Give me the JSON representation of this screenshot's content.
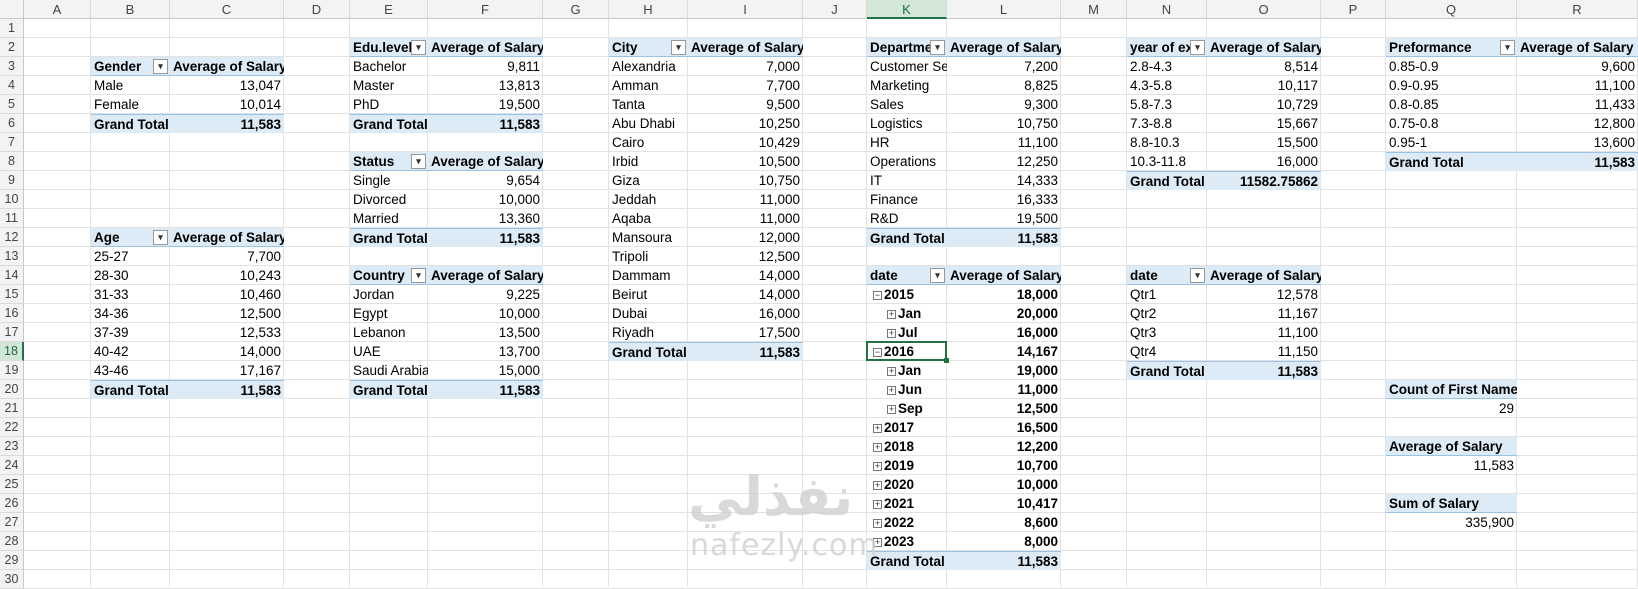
{
  "columns": [
    "A",
    "B",
    "C",
    "D",
    "E",
    "F",
    "G",
    "H",
    "I",
    "J",
    "K",
    "L",
    "M",
    "N",
    "O",
    "P",
    "Q",
    "R"
  ],
  "rows": [
    "1",
    "2",
    "3",
    "4",
    "5",
    "6",
    "7",
    "8",
    "9",
    "10",
    "11",
    "12",
    "13",
    "14",
    "15",
    "16",
    "17",
    "18",
    "19",
    "20",
    "21",
    "22",
    "23",
    "24",
    "25",
    "26",
    "27",
    "28",
    "29",
    "30"
  ],
  "selected": {
    "column": "K",
    "row": "18"
  },
  "gender": {
    "header": [
      "Gender",
      "Average of Salary"
    ],
    "rows": [
      [
        "Male",
        "13,047"
      ],
      [
        "Female",
        "10,014"
      ]
    ],
    "total": [
      "Grand Total",
      "11,583"
    ]
  },
  "age": {
    "header": [
      "Age",
      "Average of Salary"
    ],
    "rows": [
      [
        "25-27",
        "7,700"
      ],
      [
        "28-30",
        "10,243"
      ],
      [
        "31-33",
        "10,460"
      ],
      [
        "34-36",
        "12,500"
      ],
      [
        "37-39",
        "12,533"
      ],
      [
        "40-42",
        "14,000"
      ],
      [
        "43-46",
        "17,167"
      ]
    ],
    "total": [
      "Grand Total",
      "11,583"
    ]
  },
  "edu": {
    "header": [
      "Edu.level",
      "Average of Salary"
    ],
    "rows": [
      [
        "Bachelor",
        "9,811"
      ],
      [
        "Master",
        "13,813"
      ],
      [
        "PhD",
        "19,500"
      ]
    ],
    "total": [
      "Grand Total",
      "11,583"
    ]
  },
  "status": {
    "header": [
      "Status",
      "Average of Salary"
    ],
    "rows": [
      [
        "Single",
        "9,654"
      ],
      [
        "Divorced",
        "10,000"
      ],
      [
        "Married",
        "13,360"
      ]
    ],
    "total": [
      "Grand Total",
      "11,583"
    ]
  },
  "country": {
    "header": [
      "Country",
      "Average of Salary"
    ],
    "rows": [
      [
        "Jordan",
        "9,225"
      ],
      [
        "Egypt",
        "10,000"
      ],
      [
        "Lebanon",
        "13,500"
      ],
      [
        "UAE",
        "13,700"
      ],
      [
        "Saudi Arabia",
        "15,000"
      ]
    ],
    "total": [
      "Grand Total",
      "11,583"
    ]
  },
  "city": {
    "header": [
      "City",
      "Average of Salary"
    ],
    "rows": [
      [
        "Alexandria",
        "7,000"
      ],
      [
        "Amman",
        "7,700"
      ],
      [
        "Tanta",
        "9,500"
      ],
      [
        "Abu Dhabi",
        "10,250"
      ],
      [
        "Cairo",
        "10,429"
      ],
      [
        "Irbid",
        "10,500"
      ],
      [
        "Giza",
        "10,750"
      ],
      [
        "Jeddah",
        "11,000"
      ],
      [
        "Aqaba",
        "11,000"
      ],
      [
        "Mansoura",
        "12,000"
      ],
      [
        "Tripoli",
        "12,500"
      ],
      [
        "Dammam",
        "14,000"
      ],
      [
        "Beirut",
        "14,000"
      ],
      [
        "Dubai",
        "16,000"
      ],
      [
        "Riyadh",
        "17,500"
      ]
    ],
    "total": [
      "Grand Total",
      "11,583"
    ]
  },
  "department": {
    "header": [
      "Departme",
      "Average of Salary"
    ],
    "rows": [
      [
        "Customer Se",
        "7,200"
      ],
      [
        "Marketing",
        "8,825"
      ],
      [
        "Sales",
        "9,300"
      ],
      [
        "Logistics",
        "10,750"
      ],
      [
        "HR",
        "11,100"
      ],
      [
        "Operations",
        "12,250"
      ],
      [
        "IT",
        "14,333"
      ],
      [
        "Finance",
        "16,333"
      ],
      [
        "R&D",
        "19,500"
      ]
    ],
    "total": [
      "Grand Total",
      "11,583"
    ]
  },
  "date_year": {
    "header": [
      "date",
      "Average of Salary"
    ],
    "rows": [
      {
        "label": "2015",
        "value": "18,000",
        "level": 0,
        "sign": "−"
      },
      {
        "label": "Jan",
        "value": "20,000",
        "level": 1,
        "sign": "+"
      },
      {
        "label": "Jul",
        "value": "16,000",
        "level": 1,
        "sign": "+"
      },
      {
        "label": "2016",
        "value": "14,167",
        "level": 0,
        "sign": "−"
      },
      {
        "label": "Jan",
        "value": "19,000",
        "level": 1,
        "sign": "+"
      },
      {
        "label": "Jun",
        "value": "11,000",
        "level": 1,
        "sign": "+"
      },
      {
        "label": "Sep",
        "value": "12,500",
        "level": 1,
        "sign": "+"
      },
      {
        "label": "2017",
        "value": "16,500",
        "level": 0,
        "sign": "+"
      },
      {
        "label": "2018",
        "value": "12,200",
        "level": 0,
        "sign": "+"
      },
      {
        "label": "2019",
        "value": "10,700",
        "level": 0,
        "sign": "+"
      },
      {
        "label": "2020",
        "value": "10,000",
        "level": 0,
        "sign": "+"
      },
      {
        "label": "2021",
        "value": "10,417",
        "level": 0,
        "sign": "+"
      },
      {
        "label": "2022",
        "value": "8,600",
        "level": 0,
        "sign": "+"
      },
      {
        "label": "2023",
        "value": "8,000",
        "level": 0,
        "sign": "+"
      }
    ],
    "total": [
      "Grand Total",
      "11,583"
    ]
  },
  "experience": {
    "header": [
      "year of ex",
      "Average of Salary"
    ],
    "rows": [
      [
        "2.8-4.3",
        "8,514"
      ],
      [
        "4.3-5.8",
        "10,117"
      ],
      [
        "5.8-7.3",
        "10,729"
      ],
      [
        "7.3-8.8",
        "15,667"
      ],
      [
        "8.8-10.3",
        "15,500"
      ],
      [
        "10.3-11.8",
        "16,000"
      ]
    ],
    "total": [
      "Grand Total",
      "11582.75862"
    ]
  },
  "quarter": {
    "header": [
      "date",
      "Average of Salary"
    ],
    "rows": [
      [
        "Qtr1",
        "12,578"
      ],
      [
        "Qtr2",
        "11,167"
      ],
      [
        "Qtr3",
        "11,100"
      ],
      [
        "Qtr4",
        "11,150"
      ]
    ],
    "total": [
      "Grand Total",
      "11,583"
    ]
  },
  "performance": {
    "header": [
      "Preformance",
      "Average of Salary"
    ],
    "rows": [
      [
        "0.85-0.9",
        "9,600"
      ],
      [
        "0.9-0.95",
        "11,100"
      ],
      [
        "0.8-0.85",
        "11,433"
      ],
      [
        "0.75-0.8",
        "12,800"
      ],
      [
        "0.95-1",
        "13,600"
      ]
    ],
    "total": [
      "Grand Total",
      "11,583"
    ]
  },
  "summary": [
    {
      "label": "Count of First Name",
      "value": "29"
    },
    {
      "label": "Average of Salary",
      "value": "11,583"
    },
    {
      "label": "Sum of Salary",
      "value": "335,900"
    }
  ],
  "watermark": {
    "arabic": "نفذلي",
    "latin": "nafezly.com"
  },
  "colors": {
    "header_fill": "#ddebf7",
    "header_border": "#9bc2e6",
    "selection": "#217346"
  }
}
